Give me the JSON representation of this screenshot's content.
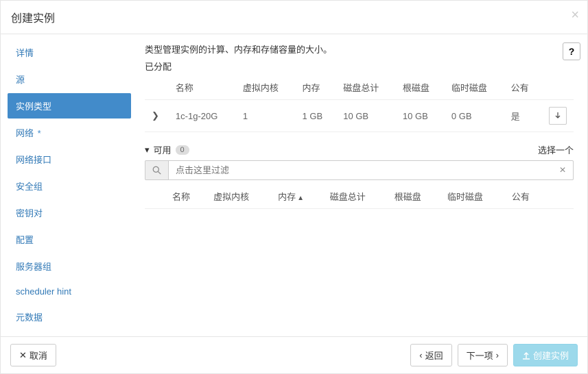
{
  "modal": {
    "title": "创建实例",
    "close_x": "×"
  },
  "sidebar": {
    "items": [
      {
        "label": "详情",
        "active": false,
        "star": false
      },
      {
        "label": "源",
        "active": false,
        "star": false
      },
      {
        "label": "实例类型",
        "active": true,
        "star": false
      },
      {
        "label": "网络",
        "active": false,
        "star": true
      },
      {
        "label": "网络接口",
        "active": false,
        "star": false
      },
      {
        "label": "安全组",
        "active": false,
        "star": false
      },
      {
        "label": "密钥对",
        "active": false,
        "star": false
      },
      {
        "label": "配置",
        "active": false,
        "star": false
      },
      {
        "label": "服务器组",
        "active": false,
        "star": false
      },
      {
        "label": "scheduler hint",
        "active": false,
        "star": false
      },
      {
        "label": "元数据",
        "active": false,
        "star": false
      }
    ]
  },
  "content": {
    "description": "类型管理实例的计算、内存和存储容量的大小。",
    "help_symbol": "?",
    "allocated_label": "已分配",
    "allocated_headers": {
      "name": "名称",
      "vcpus": "虚拟内核",
      "ram": "内存",
      "total_disk": "磁盘总计",
      "root_disk": "根磁盘",
      "ephemeral": "临时磁盘",
      "public": "公有"
    },
    "allocated_row": {
      "name": "1c-1g-20G",
      "vcpus": "1",
      "ram": "1 GB",
      "total_disk": "10 GB",
      "root_disk": "10 GB",
      "ephemeral": "0 GB",
      "public": "是"
    },
    "available_label": "可用",
    "available_count": "0",
    "select_one": "选择一个",
    "filter_placeholder": "点击这里过滤",
    "clear_x": "×",
    "available_headers": {
      "name": "名称",
      "vcpus": "虚拟内核",
      "ram": "内存",
      "total_disk": "磁盘总计",
      "root_disk": "根磁盘",
      "ephemeral": "临时磁盘",
      "public": "公有"
    }
  },
  "footer": {
    "cancel": "取消",
    "back": "返回",
    "next": "下一项",
    "create": "创建实例"
  }
}
